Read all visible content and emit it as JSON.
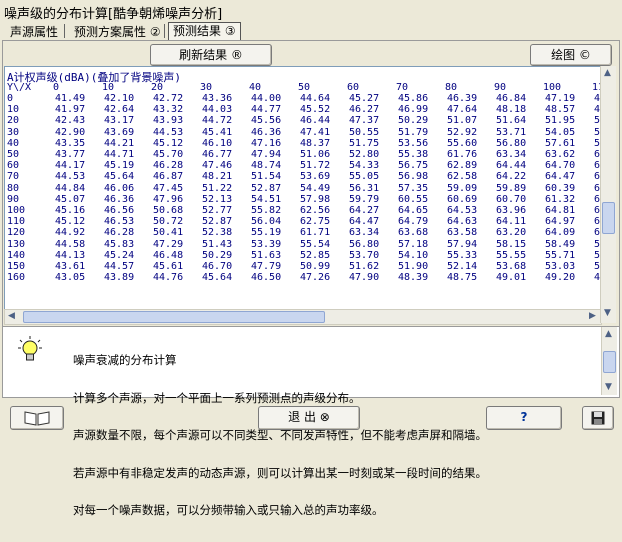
{
  "window": {
    "title": "噪声级的分布计算[酷争朝烯噪声分析]"
  },
  "tabs": [
    "声源属性",
    "预测方案属性 ②",
    "预测结果 ③"
  ],
  "toolbar": {
    "refresh_label": "刷新结果 ®",
    "plot_label": "绘图 ©"
  },
  "grid": {
    "title": "A计权声级(dBA)(叠加了背景噪声)",
    "corner": "Y\\/X",
    "columns": [
      "0",
      "10",
      "20",
      "30",
      "40",
      "50",
      "60",
      "70",
      "80",
      "90",
      "100",
      "11"
    ],
    "rows": [
      {
        "y": "0",
        "v": [
          "41.49",
          "42.10",
          "42.72",
          "43.36",
          "44.00",
          "44.64",
          "45.27",
          "45.86",
          "46.39",
          "46.84",
          "47.19",
          "47"
        ]
      },
      {
        "y": "10",
        "v": [
          "41.97",
          "42.64",
          "43.32",
          "44.03",
          "44.77",
          "45.52",
          "46.27",
          "46.99",
          "47.64",
          "48.18",
          "48.57",
          "48"
        ]
      },
      {
        "y": "20",
        "v": [
          "42.43",
          "43.17",
          "43.93",
          "44.72",
          "45.56",
          "46.44",
          "47.37",
          "50.29",
          "51.07",
          "51.64",
          "51.95",
          "52"
        ]
      },
      {
        "y": "30",
        "v": [
          "42.90",
          "43.69",
          "44.53",
          "45.41",
          "46.36",
          "47.41",
          "50.55",
          "51.79",
          "52.92",
          "53.71",
          "54.05",
          "55"
        ]
      },
      {
        "y": "40",
        "v": [
          "43.35",
          "44.21",
          "45.12",
          "46.10",
          "47.16",
          "48.37",
          "51.75",
          "53.56",
          "55.60",
          "56.80",
          "57.61",
          "57"
        ]
      },
      {
        "y": "50",
        "v": [
          "43.77",
          "44.71",
          "45.70",
          "46.77",
          "47.94",
          "51.06",
          "52.80",
          "55.38",
          "61.76",
          "63.34",
          "63.62",
          "63"
        ]
      },
      {
        "y": "60",
        "v": [
          "44.17",
          "45.19",
          "46.28",
          "47.46",
          "48.74",
          "51.72",
          "54.33",
          "56.75",
          "62.89",
          "64.44",
          "64.70",
          "64"
        ]
      },
      {
        "y": "70",
        "v": [
          "44.53",
          "45.64",
          "46.87",
          "48.21",
          "51.54",
          "53.69",
          "55.05",
          "56.98",
          "62.58",
          "64.22",
          "64.47",
          "64"
        ]
      },
      {
        "y": "80",
        "v": [
          "44.84",
          "46.06",
          "47.45",
          "51.22",
          "52.87",
          "54.49",
          "56.31",
          "57.35",
          "59.09",
          "59.89",
          "60.39",
          "60"
        ]
      },
      {
        "y": "90",
        "v": [
          "45.07",
          "46.36",
          "47.96",
          "52.13",
          "54.51",
          "57.98",
          "59.79",
          "60.55",
          "60.69",
          "60.70",
          "61.32",
          "61"
        ]
      },
      {
        "y": "100",
        "v": [
          "45.16",
          "46.56",
          "50.68",
          "52.77",
          "55.82",
          "62.56",
          "64.27",
          "64.65",
          "64.53",
          "63.96",
          "64.81",
          "64"
        ]
      },
      {
        "y": "110",
        "v": [
          "45.12",
          "46.53",
          "50.72",
          "52.87",
          "56.04",
          "62.75",
          "64.47",
          "64.79",
          "64.63",
          "64.11",
          "64.97",
          "65"
        ]
      },
      {
        "y": "120",
        "v": [
          "44.92",
          "46.28",
          "50.41",
          "52.38",
          "55.19",
          "61.71",
          "63.34",
          "63.68",
          "63.58",
          "63.20",
          "64.09",
          "64"
        ]
      },
      {
        "y": "130",
        "v": [
          "44.58",
          "45.83",
          "47.29",
          "51.43",
          "53.39",
          "55.54",
          "56.80",
          "57.18",
          "57.94",
          "58.15",
          "58.49",
          "58"
        ]
      },
      {
        "y": "140",
        "v": [
          "44.13",
          "45.24",
          "46.48",
          "50.29",
          "51.63",
          "52.85",
          "53.70",
          "54.10",
          "55.33",
          "55.55",
          "55.71",
          "55"
        ]
      },
      {
        "y": "150",
        "v": [
          "43.61",
          "44.57",
          "45.61",
          "46.70",
          "47.79",
          "50.99",
          "51.62",
          "51.90",
          "52.14",
          "53.68",
          "53.03",
          "53"
        ]
      },
      {
        "y": "160",
        "v": [
          "43.05",
          "43.89",
          "44.76",
          "45.64",
          "46.50",
          "47.26",
          "47.90",
          "48.39",
          "48.75",
          "49.01",
          "49.20",
          "49"
        ]
      }
    ]
  },
  "info": {
    "lines": [
      "噪声衰减的分布计算",
      "计算多个声源，对一个平面上一系列预测点的声级分布。",
      "声源数量不限，每个声源可以不同类型、不同发声特性，但不能考虑声屏和隔墙。",
      "若声源中有非稳定发声的动态声源，则可以计算出某一时刻或某一段时间的结果。",
      "对每一个噪声数据，可以分频带输入或只输入总的声功率级。"
    ]
  },
  "bottom": {
    "exit_label": "退 出 ⊗",
    "help_label": "?"
  }
}
